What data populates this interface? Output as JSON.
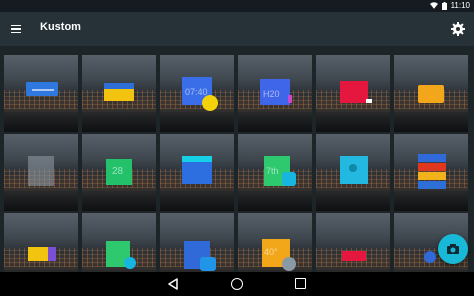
{
  "status_bar": {
    "time": "11:10"
  },
  "toolbar": {
    "title": "Kustom"
  },
  "widgets": {
    "w1": {
      "label": "",
      "sublabel": ""
    },
    "w3": {
      "label": "07:40"
    },
    "w4": {
      "label": "H20"
    },
    "w10": {
      "label": "28"
    },
    "w13": {
      "label": "7th"
    },
    "w21": {
      "label": "40°"
    }
  },
  "colors": {
    "accent": "#18b9d6",
    "toolbar": "#263238"
  },
  "fab": {
    "icon": "camera-icon"
  },
  "nav": {
    "back_icon": "back-icon",
    "home_icon": "home-icon",
    "recent_icon": "recents-icon"
  }
}
